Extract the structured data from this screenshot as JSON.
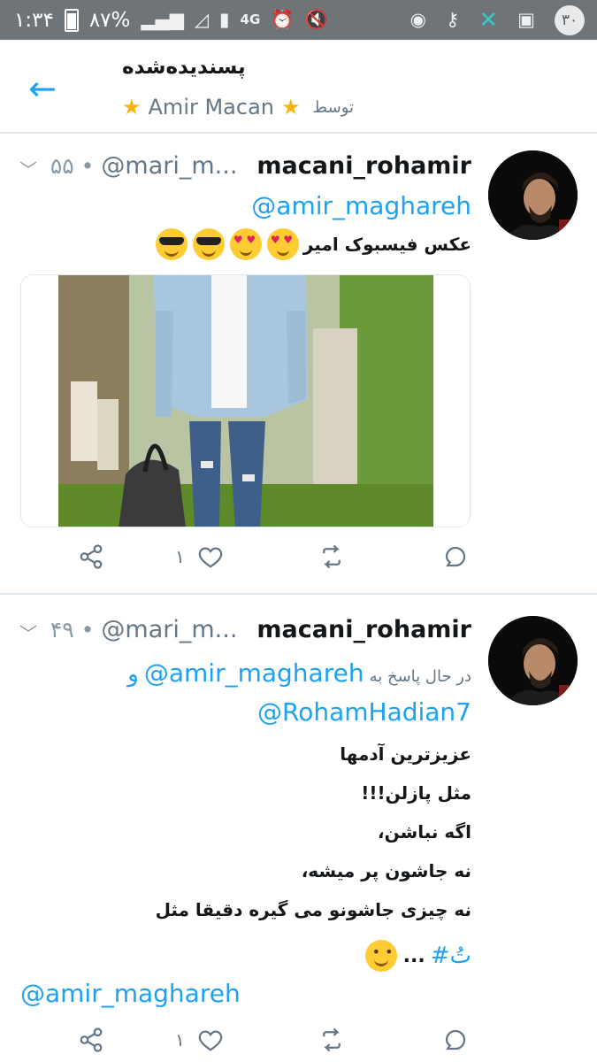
{
  "status_bar": {
    "time": "۱:۳۴",
    "battery": "۸۷%",
    "network": "4G",
    "notification_count": "۳۰"
  },
  "header": {
    "title": "پسندیده‌شده",
    "by_label": "توسط",
    "user": "Amir Macan"
  },
  "tweets": [
    {
      "name": "macani_rohamir",
      "handle": "@mari_m...",
      "time": "۵۵ •",
      "mention": "@amir_maghareh",
      "text": "عکس فیسبوک امیر",
      "likes": "۱"
    },
    {
      "name": "macani_rohamir",
      "handle": "@mari_m...",
      "time": "۴۹ •",
      "reply_prefix": "در حال پاسخ به",
      "reply_user1": "@amir_maghareh",
      "reply_and": "و",
      "reply_user2": "@RohamHadian7",
      "lines": [
        "عزیزترین آدمها",
        "مثل پازلن!!!",
        "اگه نباشن،",
        "نه جاشون پر میشه،",
        "نه چیزی جاشونو می گیره دقیقا مثل"
      ],
      "hashtag": "#تُ",
      "ellipsis": "...",
      "trailing_mention": "@amir_maghareh",
      "likes": "۱"
    }
  ],
  "colors": {
    "accent": "#1da1f2",
    "muted": "#657786",
    "status_bar": "#6f7479"
  }
}
